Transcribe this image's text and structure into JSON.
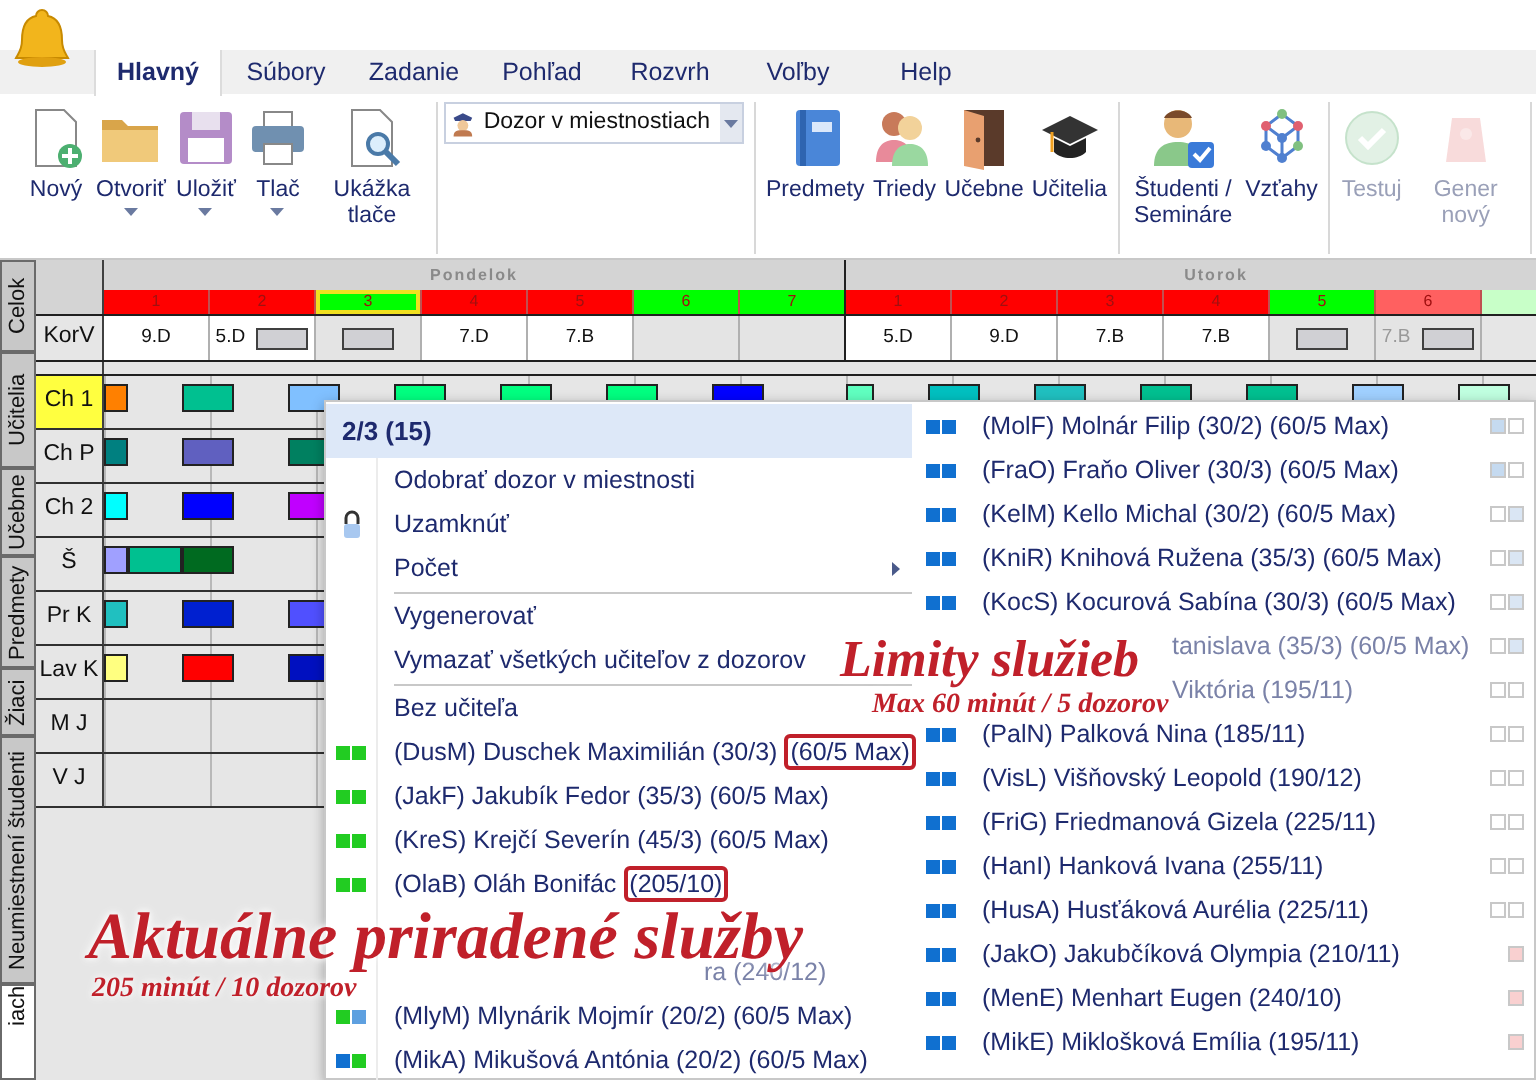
{
  "tabs": [
    {
      "label": "Hlavný",
      "selected": true
    },
    {
      "label": "Súbory",
      "selected": false
    },
    {
      "label": "Zadanie",
      "selected": false
    },
    {
      "label": "Pohľad",
      "selected": false
    },
    {
      "label": "Rozvrh",
      "selected": false
    },
    {
      "label": "Voľby",
      "selected": false
    },
    {
      "label": "Help",
      "selected": false
    }
  ],
  "ribbon": [
    {
      "kind": "buttons",
      "buttons": [
        {
          "kind": "new",
          "label": "Nový",
          "has_menu": false,
          "disabled": false
        },
        {
          "kind": "open",
          "label": "Otvoriť",
          "has_menu": true,
          "disabled": false
        },
        {
          "kind": "save",
          "label": "Uložiť",
          "has_menu": true,
          "disabled": false
        },
        {
          "kind": "print",
          "label": "Tlač",
          "has_menu": true,
          "disabled": false
        },
        {
          "kind": "preview",
          "label": "Ukážka tlače",
          "has_menu": false,
          "disabled": false
        }
      ]
    },
    {
      "kind": "dropdown",
      "label": "Dozor v miestnostiach"
    },
    {
      "kind": "buttons",
      "buttons": [
        {
          "kind": "subjects",
          "label": "Predmety",
          "has_menu": false,
          "disabled": false
        },
        {
          "kind": "classes",
          "label": "Triedy",
          "has_menu": false,
          "disabled": false
        },
        {
          "kind": "rooms",
          "label": "Učebne",
          "has_menu": false,
          "disabled": false
        },
        {
          "kind": "teachers",
          "label": "Učitelia",
          "has_menu": false,
          "disabled": false
        }
      ]
    },
    {
      "kind": "buttons",
      "buttons": [
        {
          "kind": "students",
          "label": "Študenti / Semináre",
          "has_menu": false,
          "disabled": false
        },
        {
          "kind": "relations",
          "label": "Vzťahy",
          "has_menu": false,
          "disabled": false
        }
      ]
    },
    {
      "kind": "buttons",
      "buttons": [
        {
          "kind": "test",
          "label": "Testuj",
          "has_menu": false,
          "disabled": true
        },
        {
          "kind": "generate",
          "label": "Gener nový",
          "has_menu": false,
          "disabled": true
        }
      ]
    }
  ],
  "side_tabs": [
    {
      "label": "Celok",
      "selected": false
    },
    {
      "label": "Učitelia",
      "selected": false
    },
    {
      "label": "Učebne",
      "selected": false
    },
    {
      "label": "Predmety",
      "selected": false
    },
    {
      "label": "Žiaci",
      "selected": false
    },
    {
      "label": "Neumiestnení študenti",
      "selected": false
    },
    {
      "label": "iach",
      "selected": true
    }
  ],
  "timetable": {
    "days": [
      {
        "name": "Pondelok",
        "periods": [
          {
            "label": "1",
            "color": "#ff0000",
            "selected": false
          },
          {
            "label": "2",
            "color": "#ff0000",
            "selected": false
          },
          {
            "label": "3",
            "color": "#00ff00",
            "selected": true
          },
          {
            "label": "4",
            "color": "#ff0000",
            "selected": false
          },
          {
            "label": "5",
            "color": "#ff0000",
            "selected": false
          },
          {
            "label": "6",
            "color": "#00ff00",
            "selected": false
          },
          {
            "label": "7",
            "color": "#00ff00",
            "selected": false
          }
        ]
      },
      {
        "name": "Utorok",
        "periods": [
          {
            "label": "1",
            "color": "#ff0000",
            "selected": false
          },
          {
            "label": "2",
            "color": "#ff0000",
            "selected": false
          },
          {
            "label": "3",
            "color": "#ff0000",
            "selected": false
          },
          {
            "label": "4",
            "color": "#ff0000",
            "selected": false
          },
          {
            "label": "5",
            "color": "#00ff00",
            "selected": false
          },
          {
            "label": "6",
            "color": "#ff6060",
            "selected": false
          },
          {
            "color": "#c8ffc8",
            "selected": false
          }
        ]
      }
    ],
    "korv": {
      "label": "KorV",
      "cells": [
        {
          "text": "9.D",
          "box": false
        },
        {
          "text": "5.D",
          "box": true
        },
        {
          "box": true
        },
        {
          "text": "7.D",
          "box": false
        },
        {
          "text": "7.B",
          "box": false
        },
        {
          "box": false
        },
        {
          "box": false
        },
        {
          "text": "5.D",
          "box": false
        },
        {
          "text": "9.D",
          "box": false
        },
        {
          "text": "7.B",
          "box": false
        },
        {
          "text": "7.B",
          "box": false
        },
        {
          "box": true
        },
        {
          "text": "7.B",
          "box": true
        }
      ]
    },
    "rows": [
      {
        "label": "Ch 1",
        "selected": true,
        "lead": {
          "color": "#ff8000"
        },
        "slots": [
          {
            "color": "#00c090"
          },
          {
            "color": "#80c0ff"
          },
          {
            "color": "#00ff80"
          },
          {
            "color": "#00ff80"
          },
          {
            "color": "#00ff80"
          },
          {
            "color": "#0000ff"
          },
          {
            "color": "#60ffc0"
          },
          {
            "color": "#00c0c0"
          },
          {
            "color": "#20c0c0"
          },
          {
            "color": "#00c090"
          },
          {
            "color": "#00c090"
          },
          {
            "color": "#a0d0ff"
          },
          {
            "color": "#c0ffe0"
          }
        ]
      },
      {
        "label": "Ch P",
        "selected": false,
        "lead": {
          "color": "#008080"
        },
        "slots": [
          {
            "color": "#6060c0"
          },
          {
            "color": "#008060"
          }
        ]
      },
      {
        "label": "Ch 2",
        "selected": false,
        "lead": {
          "color": "#00ffff"
        },
        "slots": [
          {
            "color": "#0000ff"
          },
          {
            "color": "#c000ff"
          }
        ]
      },
      {
        "label": "Š",
        "selected": false,
        "lead": {
          "color": "#a0a0ff"
        },
        "slots": [
          {
            "fill": {
              "color": "#00c090"
            },
            "color": "#006a20"
          }
        ]
      },
      {
        "label": "Pr K",
        "selected": false,
        "lead": {
          "color": "#20c0c0"
        },
        "slots": [
          {
            "color": "#0020d0"
          },
          {
            "color": "#5050ff"
          }
        ]
      },
      {
        "label": "Lav K",
        "selected": false,
        "lead": {
          "color": "#ffff80"
        },
        "slots": [
          {
            "color": "#ff0000"
          },
          {
            "color": "#0010c0"
          }
        ]
      },
      {
        "label": "M J",
        "selected": false,
        "slots": []
      },
      {
        "label": "V J",
        "selected": false,
        "slots": []
      }
    ]
  },
  "menu": {
    "header": "2/3 (15)",
    "left": [
      {
        "kind": "action",
        "label": "Odobrať dozor v miestnosti"
      },
      {
        "kind": "lock",
        "label": "Uzamknúť"
      },
      {
        "kind": "submenu",
        "label": "Počet"
      },
      {
        "kind": "separator"
      },
      {
        "kind": "action",
        "label": "Vygenerovať"
      },
      {
        "kind": "action",
        "label": "Vymazať všetkých učiteľov z dozorov"
      },
      {
        "kind": "separator"
      },
      {
        "kind": "action",
        "label": "Bez učiteľa"
      },
      {
        "kind": "teacher",
        "label": "(DusM) Duschek Maximilián (30/3)",
        "circled": "(60/5 Max)",
        "marks": [
          {
            "color": "#22cc22"
          },
          {
            "color": "#22cc22"
          }
        ]
      },
      {
        "kind": "teacher",
        "label": "(JakF) Jakubík Fedor (35/3) (60/5 Max)",
        "marks": [
          {
            "color": "#22cc22"
          },
          {
            "color": "#22cc22"
          }
        ]
      },
      {
        "kind": "teacher",
        "label": "(KreS) Krejčí Severín (45/3) (60/5 Max)",
        "marks": [
          {
            "color": "#22cc22"
          },
          {
            "color": "#22cc22"
          }
        ]
      },
      {
        "kind": "teacher",
        "label": "(OlaB) Oláh Bonifác",
        "circled": "(205/10)",
        "marks": [
          {
            "color": "#22cc22"
          },
          {
            "color": "#22cc22"
          }
        ]
      },
      {
        "kind": "covered"
      },
      {
        "kind": "partial",
        "label": "ra (240/12)"
      },
      {
        "kind": "teacher",
        "label": "(MlyM) Mlynárik Mojmír (20/2) (60/5 Max)",
        "marks": [
          {
            "color": "#22cc22"
          },
          {
            "color": "#5ea0e0"
          }
        ]
      },
      {
        "kind": "teacher",
        "label": "(MikA) Mikušová Antónia (20/2) (60/5 Max)",
        "marks": [
          {
            "color": "#1070d0"
          },
          {
            "color": "#22cc22"
          }
        ]
      }
    ],
    "right": [
      {
        "kind": "teacher",
        "label": "(MolF) Molnár Filip (30/2) (60/5 Max)",
        "marks": [
          {
            "color": "#1070d0"
          },
          {
            "color": "#1070d0"
          }
        ],
        "side": [
          {
            "color": "#c5daf0"
          },
          {
            "color": "#ffffff"
          }
        ]
      },
      {
        "kind": "teacher",
        "label": "(FraO) Fraňo Oliver (30/3) (60/5 Max)",
        "marks": [
          {
            "color": "#1070d0"
          },
          {
            "color": "#1070d0"
          }
        ],
        "side": [
          {
            "color": "#c5daf0"
          },
          {
            "color": "#ffffff"
          }
        ]
      },
      {
        "kind": "teacher",
        "label": "(KelM) Kello Michal (30/2) (60/5 Max)",
        "marks": [
          {
            "color": "#1070d0"
          },
          {
            "color": "#1070d0"
          }
        ],
        "side": [
          {
            "color": "#ffffff"
          },
          {
            "color": "#dae6f4"
          }
        ]
      },
      {
        "kind": "teacher",
        "label": "(KniR) Knihová Ružena (35/3) (60/5 Max)",
        "marks": [
          {
            "color": "#1070d0"
          },
          {
            "color": "#1070d0"
          }
        ],
        "side": [
          {
            "color": "#ffffff"
          },
          {
            "color": "#dae6f4"
          }
        ]
      },
      {
        "kind": "teacher",
        "label": "(KocS) Kocurová Sabína (30/3) (60/5 Max)",
        "marks": [
          {
            "color": "#1070d0"
          },
          {
            "color": "#1070d0"
          }
        ],
        "side": [
          {
            "color": "#ffffff"
          },
          {
            "color": "#dae6f4"
          }
        ]
      },
      {
        "kind": "partial",
        "label": "tanislava (35/3) (60/5 Max)",
        "side": [
          {
            "color": "#ffffff"
          },
          {
            "color": "#dae6f4"
          }
        ]
      },
      {
        "kind": "partial",
        "label": "Viktória (195/11)",
        "side": [
          {
            "color": "#ffffff"
          },
          {
            "color": "#ffffff"
          }
        ]
      },
      {
        "kind": "teacher",
        "label": "(PalN) Palková Nina (185/11)",
        "marks": [
          {
            "color": "#1070d0"
          },
          {
            "color": "#1070d0"
          }
        ],
        "side": [
          {
            "color": "#ffffff"
          },
          {
            "color": "#ffffff"
          }
        ]
      },
      {
        "kind": "teacher",
        "label": "(VisL) Višňovský Leopold (190/12)",
        "marks": [
          {
            "color": "#1070d0"
          },
          {
            "color": "#1070d0"
          }
        ],
        "side": [
          {
            "color": "#ffffff"
          },
          {
            "color": "#ffffff"
          }
        ]
      },
      {
        "kind": "teacher",
        "label": "(FriG) Friedmanová Gizela (225/11)",
        "marks": [
          {
            "color": "#1070d0"
          },
          {
            "color": "#1070d0"
          }
        ],
        "side": [
          {
            "color": "#ffffff"
          },
          {
            "color": "#ffffff"
          }
        ]
      },
      {
        "kind": "teacher",
        "label": "(HanI) Hanková Ivana (255/11)",
        "marks": [
          {
            "color": "#1070d0"
          },
          {
            "color": "#1070d0"
          }
        ],
        "side": [
          {
            "color": "#ffffff"
          },
          {
            "color": "#ffffff"
          }
        ]
      },
      {
        "kind": "teacher",
        "label": "(HusA) Husťáková Aurélia (225/11)",
        "marks": [
          {
            "color": "#1070d0"
          },
          {
            "color": "#1070d0"
          }
        ],
        "side": [
          {
            "color": "#ffffff"
          },
          {
            "color": "#ffffff"
          }
        ]
      },
      {
        "kind": "teacher",
        "label": "(JakO) Jakubčíková Olympia (210/11)",
        "marks": [
          {
            "color": "#1070d0"
          },
          {
            "color": "#1070d0"
          }
        ],
        "side": [
          {
            "color": "#f9d0d0"
          }
        ]
      },
      {
        "kind": "teacher",
        "label": "(MenE) Menhart Eugen (240/10)",
        "marks": [
          {
            "color": "#1070d0"
          },
          {
            "color": "#1070d0"
          }
        ],
        "side": [
          {
            "color": "#f9d0d0"
          }
        ]
      },
      {
        "kind": "teacher",
        "label": "(MikE) Miklošková Emília (195/11)",
        "marks": [
          {
            "color": "#1070d0"
          },
          {
            "color": "#1070d0"
          }
        ],
        "side": [
          {
            "color": "#f9d0d0"
          }
        ]
      }
    ]
  },
  "annotations": [
    {
      "title": "Limity služieb",
      "subtitle": "Max 60 minút / 5 dozorov"
    },
    {
      "title": "Aktuálne priradené služby",
      "subtitle": "205 minút / 10 dozorov"
    }
  ]
}
